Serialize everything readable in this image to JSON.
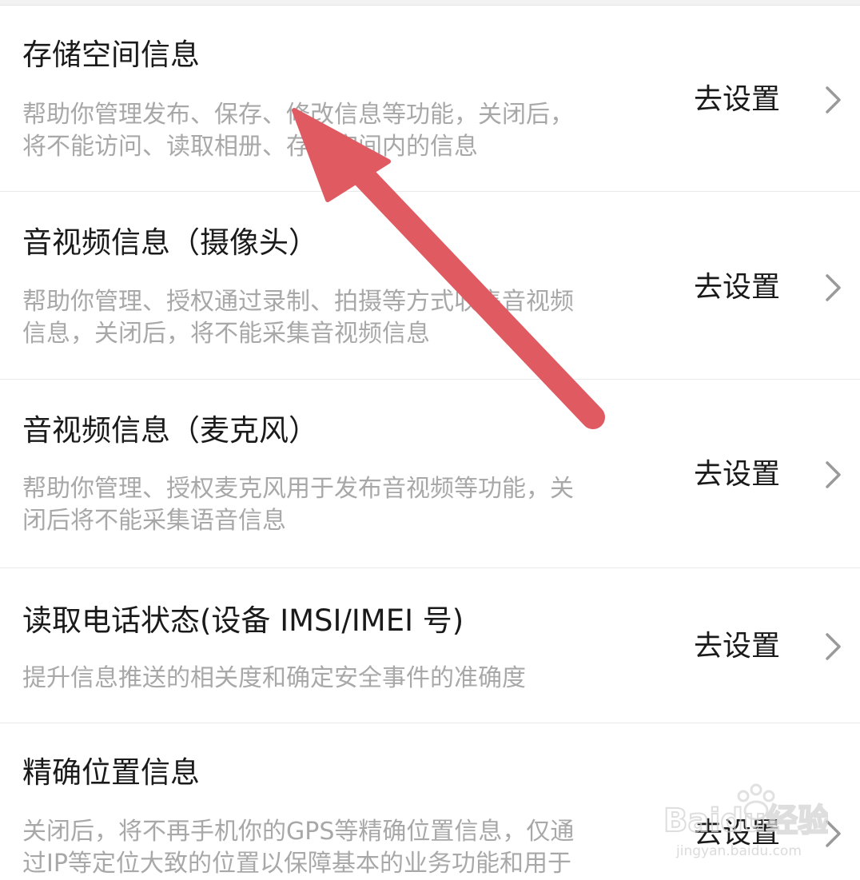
{
  "rows": [
    {
      "title": "存储空间信息",
      "desc_line1": "帮助你管理发布、保存、修改信息等功能，关闭后，",
      "desc_line2": "将不能访问、读取相册、存储空间内的信息",
      "action": "去设置"
    },
    {
      "title": "音视频信息（摄像头）",
      "desc_line1": "帮助你管理、授权通过录制、拍摄等方式收集音视频",
      "desc_line2": "信息，关闭后，将不能采集音视频信息",
      "action": "去设置"
    },
    {
      "title": "音视频信息（麦克风）",
      "desc_line1": "帮助你管理、授权麦克风用于发布音视频等功能，关",
      "desc_line2": "闭后将不能采集语音信息",
      "action": "去设置"
    },
    {
      "title": "读取电话状态(设备 IMSI/IMEI 号)",
      "desc_line1": "提升信息推送的相关度和确定安全事件的准确度",
      "desc_line2": "",
      "action": "去设置"
    },
    {
      "title": "精确位置信息",
      "desc_line1": "关闭后，将不再手机你的GPS等精确位置信息，仅通",
      "desc_line2": "过IP等定位大致的位置以保障基本的业务功能和用于",
      "action": "去设置"
    }
  ],
  "watermark": {
    "brand": "Baidu经验",
    "url": "jingyan.baidu.com"
  },
  "colors": {
    "arrow": "#e05a62",
    "title": "#1a1a1a",
    "desc": "#a8a8a8",
    "divider": "#e9e9e9"
  },
  "icons": {
    "chevron": "chevron-right-icon",
    "annotation": "annotation-arrow-icon"
  }
}
